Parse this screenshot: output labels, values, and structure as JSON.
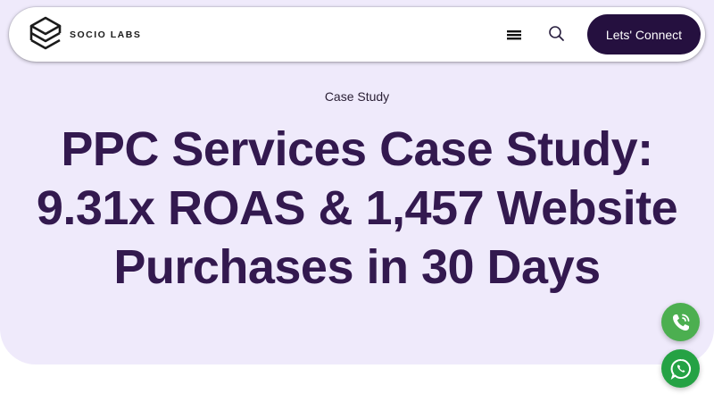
{
  "header": {
    "logo_text": "SOCIO LABS",
    "cta_label": "Lets' Connect"
  },
  "hero": {
    "eyebrow": "Case Study",
    "headline_line1": "PPC Services Case Study:",
    "headline_line2": "9.31x ROAS & 1,457 Website",
    "headline_line3": "Purchases in 30 Days"
  },
  "icons": {
    "logo": "stacked-cube-logo-icon",
    "menu": "hamburger-menu-icon",
    "search": "search-icon",
    "phone": "phone-icon",
    "whatsapp": "whatsapp-icon"
  },
  "colors": {
    "hero_bg": "#efeafb",
    "headline": "#33194f",
    "cta_bg": "#25103f",
    "phone_fab": "#4caf50",
    "whatsapp_fab": "#25a244"
  }
}
